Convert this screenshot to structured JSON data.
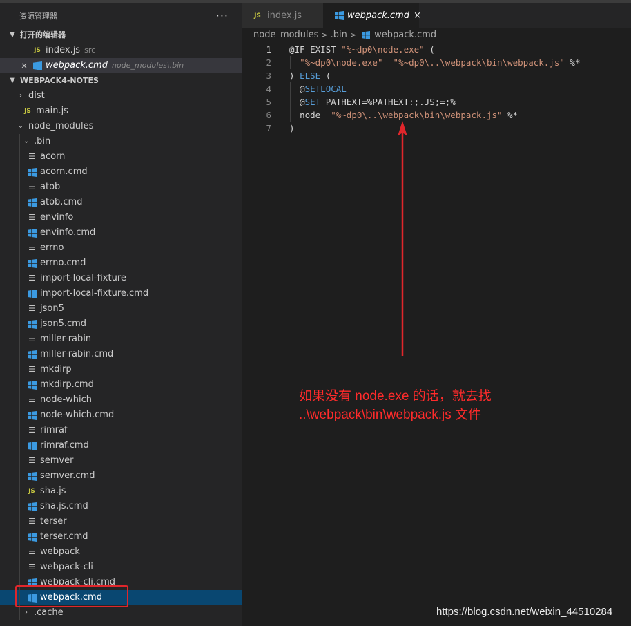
{
  "explorer": {
    "title": "资源管理器",
    "more": "···",
    "open_editors": {
      "label": "打开的编辑器",
      "items": [
        {
          "close": "",
          "name": "index.js",
          "path": "src"
        },
        {
          "close": "×",
          "name": "webpack.cmd",
          "path": "node_modules\\.bin"
        }
      ]
    },
    "workspace": {
      "label": "WEBPACK4-NOTES",
      "dist": "dist",
      "main_js": "main.js",
      "node_modules": "node_modules",
      "bin": ".bin",
      "bin_files": [
        "acorn",
        "acorn.cmd",
        "atob",
        "atob.cmd",
        "envinfo",
        "envinfo.cmd",
        "errno",
        "errno.cmd",
        "import-local-fixture",
        "import-local-fixture.cmd",
        "json5",
        "json5.cmd",
        "miller-rabin",
        "miller-rabin.cmd",
        "mkdirp",
        "mkdirp.cmd",
        "node-which",
        "node-which.cmd",
        "rimraf",
        "rimraf.cmd",
        "semver",
        "semver.cmd",
        "sha.js",
        "sha.js.cmd",
        "terser",
        "terser.cmd",
        "webpack",
        "webpack-cli",
        "webpack-cli.cmd",
        "webpack.cmd"
      ],
      "cache": ".cache"
    }
  },
  "tabs": [
    {
      "label": "index.js",
      "icon": "JS"
    },
    {
      "label": "webpack.cmd",
      "close": "×"
    }
  ],
  "breadcrumb": {
    "part1": "node_modules",
    "part2": ".bin",
    "part3": "webpack.cmd",
    "sep": ">"
  },
  "code": {
    "lines": [
      "1",
      "2",
      "3",
      "4",
      "5",
      "6",
      "7"
    ],
    "l1a": "@IF EXIST ",
    "l1b": "\"%~dp0\\node.exe\"",
    "l1c": " (",
    "l2a": "\"%~dp0\\node.exe\"",
    "l2b": "\"%~dp0\\..\\webpack\\bin\\webpack.js\"",
    "l2c": " %*",
    "l3a": ") ",
    "l3b": "ELSE",
    "l3c": " (",
    "l4a": "@",
    "l4b": "SETLOCAL",
    "l5a": "@",
    "l5b": "SET",
    "l5c": " PATHEXT=%PATHEXT:;.JS;=;%",
    "l6a": "node  ",
    "l6b": "\"%~dp0\\..\\webpack\\bin\\webpack.js\"",
    "l6c": " %*",
    "l7a": ")"
  },
  "annotation": {
    "line1": "如果没有 node.exe 的话，就去找",
    "line2": "..\\webpack\\bin\\webpack.js 文件",
    "color": "#ff2b2b"
  },
  "watermark": "https://blog.csdn.net/weixin_44510284"
}
